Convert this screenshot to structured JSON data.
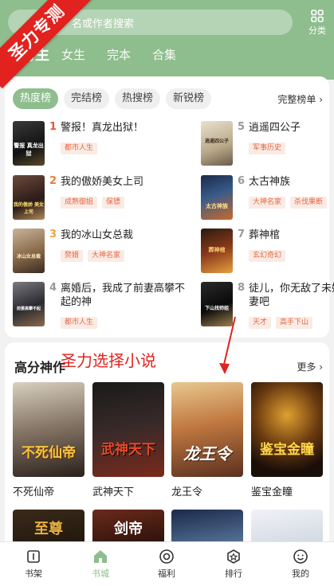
{
  "watermark": {
    "text": "圣力专测"
  },
  "header": {
    "search_placeholder": "名或作者搜索",
    "category_label": "分类",
    "tabs": [
      {
        "label": "男生",
        "active": true
      },
      {
        "label": "女生",
        "active": false
      },
      {
        "label": "完本",
        "active": false
      },
      {
        "label": "合集",
        "active": false
      }
    ]
  },
  "ranking": {
    "chips": [
      {
        "label": "热度榜",
        "active": true
      },
      {
        "label": "完结榜",
        "active": false
      },
      {
        "label": "热搜榜",
        "active": false
      },
      {
        "label": "新锐榜",
        "active": false
      }
    ],
    "full_list_label": "完整榜单",
    "items": [
      {
        "rank": "1",
        "title": "警报！真龙出狱！",
        "tags": [
          "都市人生"
        ],
        "cover_text": "警报 真龙出狱"
      },
      {
        "rank": "2",
        "title": "我的傲娇美女上司",
        "tags": [
          "成熟御姐",
          "保镖"
        ],
        "cover_text": "我的傲娇 美女上司"
      },
      {
        "rank": "3",
        "title": "我的冰山女总裁",
        "tags": [
          "赘婿",
          "大神名家"
        ],
        "cover_text": "冰山女总裁"
      },
      {
        "rank": "4",
        "title": "离婚后，我成了前妻高攀不起的神",
        "tags": [
          "都市人生"
        ],
        "cover_text": "前妻高攀不起"
      },
      {
        "rank": "5",
        "title": "逍遥四公子",
        "tags": [
          "军事历史"
        ],
        "cover_text": "逍遥四公子"
      },
      {
        "rank": "6",
        "title": "太古神族",
        "tags": [
          "大神名家",
          "杀伐果断"
        ],
        "cover_text": "太古神族"
      },
      {
        "rank": "7",
        "title": "葬神棺",
        "tags": [
          "玄幻奇幻"
        ],
        "cover_text": "葬神棺"
      },
      {
        "rank": "8",
        "title": "徒儿，你无敌了未婚妻吧",
        "tags": [
          "天才",
          "高手下山"
        ],
        "cover_text": "下山找师姐"
      }
    ]
  },
  "high_score": {
    "title": "高分神作",
    "more_label": "更多",
    "books": [
      {
        "title": "不死仙帝",
        "cover_text": "不死仙帝"
      },
      {
        "title": "武神天下",
        "cover_text": "武神天下"
      },
      {
        "title": "龙王令",
        "cover_text": "龙王令"
      },
      {
        "title": "鉴宝金瞳",
        "cover_text": "鉴宝金瞳"
      }
    ],
    "row2_covers": [
      "至尊",
      "剑帝",
      "",
      ""
    ]
  },
  "annotation": {
    "text": "圣力选择小说"
  },
  "bottom_nav": [
    {
      "label": "书架",
      "icon": "bookshelf-icon",
      "active": false
    },
    {
      "label": "书城",
      "icon": "bookstore-icon",
      "active": true
    },
    {
      "label": "福利",
      "icon": "welfare-icon",
      "active": false
    },
    {
      "label": "排行",
      "icon": "ranking-icon",
      "active": false
    },
    {
      "label": "我的",
      "icon": "profile-icon",
      "active": false
    }
  ],
  "colors": {
    "brand_green": "#8ebd8e",
    "tag_text": "#e36a42",
    "tag_bg": "#fbebe5",
    "annotation_red": "#e0241f",
    "rank_1": "#e8543a",
    "rank_2": "#f07a3a",
    "rank_3": "#f4a13c",
    "rank_other": "#999999"
  }
}
